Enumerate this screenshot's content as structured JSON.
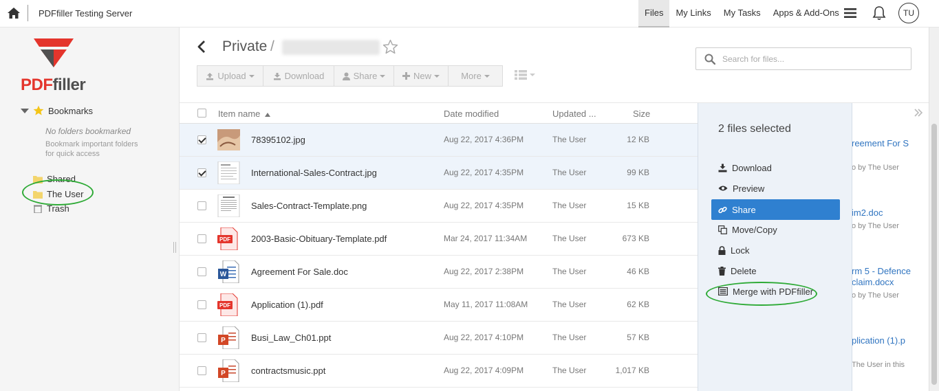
{
  "topbar": {
    "app_title": "PDFfiller Testing Server",
    "nav": [
      "Files",
      "My Links",
      "My Tasks",
      "Apps & Add-Ons"
    ],
    "active_nav": "Files",
    "avatar_initials": "TU",
    "icons": {
      "home": "home-icon",
      "menu": "hamburger-menu-icon",
      "notifications": "bell-icon"
    }
  },
  "sidebar": {
    "logo": {
      "pdf": "PDF",
      "filler": "filler"
    },
    "bookmarks_label": "Bookmarks",
    "no_bookmarks": "No folders bookmarked",
    "bookmark_hint": "Bookmark important folders for quick access",
    "folders": [
      {
        "label": "Shared"
      },
      {
        "label": "The User"
      },
      {
        "label": "Trash"
      }
    ]
  },
  "header": {
    "breadcrumb_root": "Private",
    "breadcrumb_separator": "/"
  },
  "toolbar": {
    "upload": "Upload",
    "download": "Download",
    "share": "Share",
    "new": "New",
    "more": "More"
  },
  "search": {
    "placeholder": "Search for files..."
  },
  "table": {
    "columns": {
      "name": "Item name",
      "date": "Date modified",
      "updated": "Updated ...",
      "size": "Size"
    },
    "rows": [
      {
        "name": "78395102.jpg",
        "date": "Aug 22, 2017 4:36PM",
        "user": "The User",
        "size": "12 KB",
        "type": "jpg-photo",
        "checked": true
      },
      {
        "name": "International-Sales-Contract.jpg",
        "date": "Aug 22, 2017 4:35PM",
        "user": "The User",
        "size": "99 KB",
        "type": "jpg-doc",
        "checked": true
      },
      {
        "name": "Sales-Contract-Template.png",
        "date": "Aug 22, 2017 4:35PM",
        "user": "The User",
        "size": "15 KB",
        "type": "png-doc",
        "checked": false
      },
      {
        "name": "2003-Basic-Obituary-Template.pdf",
        "date": "Mar 24, 2017 11:34AM",
        "user": "The User",
        "size": "673 KB",
        "type": "pdf",
        "checked": false
      },
      {
        "name": "Agreement For Sale.doc",
        "date": "Aug 22, 2017 2:38PM",
        "user": "The User",
        "size": "46 KB",
        "type": "doc",
        "checked": false
      },
      {
        "name": "Application (1).pdf",
        "date": "May 11, 2017 11:08AM",
        "user": "The User",
        "size": "62 KB",
        "type": "pdf",
        "checked": false
      },
      {
        "name": "Busi_Law_Ch01.ppt",
        "date": "Aug 22, 2017 4:10PM",
        "user": "The User",
        "size": "57 KB",
        "type": "ppt",
        "checked": false
      },
      {
        "name": "contractsmusic.ppt",
        "date": "Aug 22, 2017 4:09PM",
        "user": "The User",
        "size": "1,017 KB",
        "type": "ppt",
        "checked": false
      }
    ]
  },
  "panel": {
    "title": "2 files selected",
    "actions": [
      "Download",
      "Preview",
      "Share",
      "Move/Copy",
      "Lock",
      "Delete",
      "Merge with PDFfiller"
    ],
    "active_action": "Share"
  },
  "activity": [
    {
      "link": "reement For S",
      "meta": "o by The User"
    },
    {
      "link": "im2.doc",
      "meta": "o by The User"
    },
    {
      "link": "rm 5 - Defence",
      "link2": "claim.docx",
      "meta": "o by The User"
    },
    {
      "link": "plication (1).p",
      "meta": "The User in this"
    }
  ],
  "colors": {
    "accent": "#2f80d0",
    "logo_red": "#e4352c",
    "annotation": "#2eaa36"
  }
}
